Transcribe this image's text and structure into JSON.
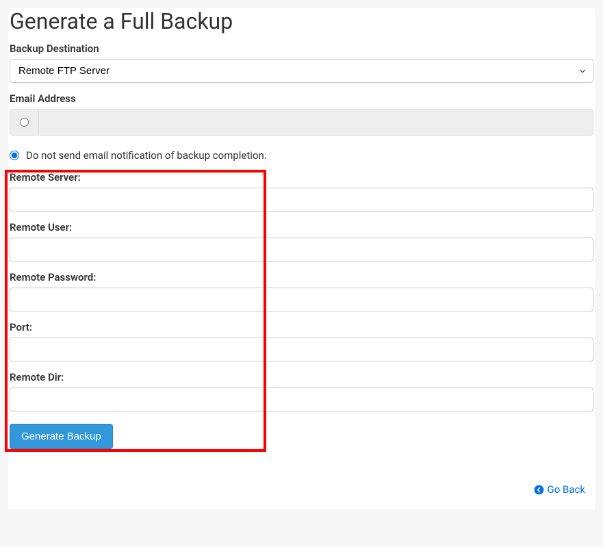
{
  "page": {
    "title": "Generate a Full Backup"
  },
  "backupDestination": {
    "label": "Backup Destination",
    "selected": "Remote FTP Server"
  },
  "emailSection": {
    "label": "Email Address",
    "doNotSendLabel": "Do not send email notification of backup completion."
  },
  "fields": {
    "remoteServer": {
      "label": "Remote Server:"
    },
    "remoteUser": {
      "label": "Remote User:"
    },
    "remotePassword": {
      "label": "Remote Password:"
    },
    "port": {
      "label": "Port:"
    },
    "remoteDir": {
      "label": "Remote Dir:"
    }
  },
  "actions": {
    "generate": "Generate Backup",
    "goBack": "Go Back"
  }
}
